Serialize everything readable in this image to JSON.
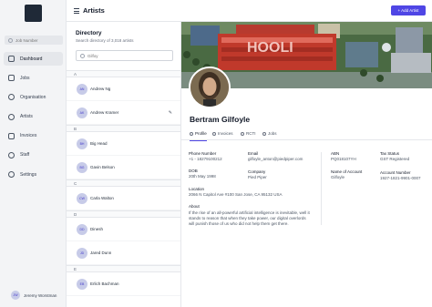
{
  "sidebar": {
    "search_placeholder": "Job Number",
    "items": [
      {
        "label": "Dashboard"
      },
      {
        "label": "Jobs"
      },
      {
        "label": "Organisation"
      },
      {
        "label": "Artists"
      },
      {
        "label": "Invoices"
      },
      {
        "label": "Staff"
      },
      {
        "label": "Settings"
      }
    ],
    "user": {
      "name": "Jeremy Worstman",
      "initials": "JW"
    }
  },
  "header": {
    "title": "Artists",
    "add_button": "+ Add Artist"
  },
  "directory": {
    "title": "Directory",
    "subtitle": "Search directory of 3,018 artists",
    "search_placeholder": "Gilfoy",
    "groups": [
      {
        "letter": "A",
        "artists": [
          {
            "initials": "AN",
            "name": "Andrew Ng"
          },
          {
            "initials": "AK",
            "name": "Andrew Kramer"
          }
        ]
      },
      {
        "letter": "B",
        "artists": [
          {
            "initials": "BH",
            "name": "Big Head"
          },
          {
            "initials": "BG",
            "name": "Gavin Belson"
          }
        ]
      },
      {
        "letter": "C",
        "artists": [
          {
            "initials": "CW",
            "name": "Carla Walton"
          }
        ]
      },
      {
        "letter": "D",
        "artists": [
          {
            "initials": "DD",
            "name": "Dinesh"
          },
          {
            "initials": "JD",
            "name": "Jared Dunn"
          }
        ]
      },
      {
        "letter": "E",
        "artists": [
          {
            "initials": "EB",
            "name": "Erlich Bachman"
          }
        ]
      }
    ]
  },
  "profile": {
    "cover_text": "HOOLI",
    "name": "Bertram Gilfoyle",
    "tabs": [
      {
        "label": "Profile"
      },
      {
        "label": "Invoices"
      },
      {
        "label": "RCTI"
      },
      {
        "label": "Jobs"
      }
    ],
    "phone_label": "Phone Number",
    "phone": "+1 - 18279100212",
    "email_label": "Email",
    "email": "gilfoyle_anton@piedpiper.com",
    "dob_label": "DOB",
    "dob": "20th May 1998",
    "company_label": "Company",
    "company": "Pied Piper",
    "location_label": "Location",
    "location": "2066 N Capitol Ave #100 San Jose, CA 95132 USA",
    "about_label": "About",
    "about": "If the rise of an all-powerful artificial intelligence is inevitable, well it stands to reason that when they take power, our digital overlords will punish those of us who did not help them get there.",
    "abn_label": "ABN",
    "abn": "PQ018107YH",
    "tax_label": "Tax Status",
    "tax": "GST Registered",
    "account_name_label": "Name of Account",
    "account_name": "Gilfoyle",
    "account_number_label": "Account Number",
    "account_number": "1927-1821-9901-0007"
  },
  "colors": {
    "accent": "#4f46e5",
    "avatar_bg": "#c7cbe8",
    "cover_building": "#c0392b"
  }
}
